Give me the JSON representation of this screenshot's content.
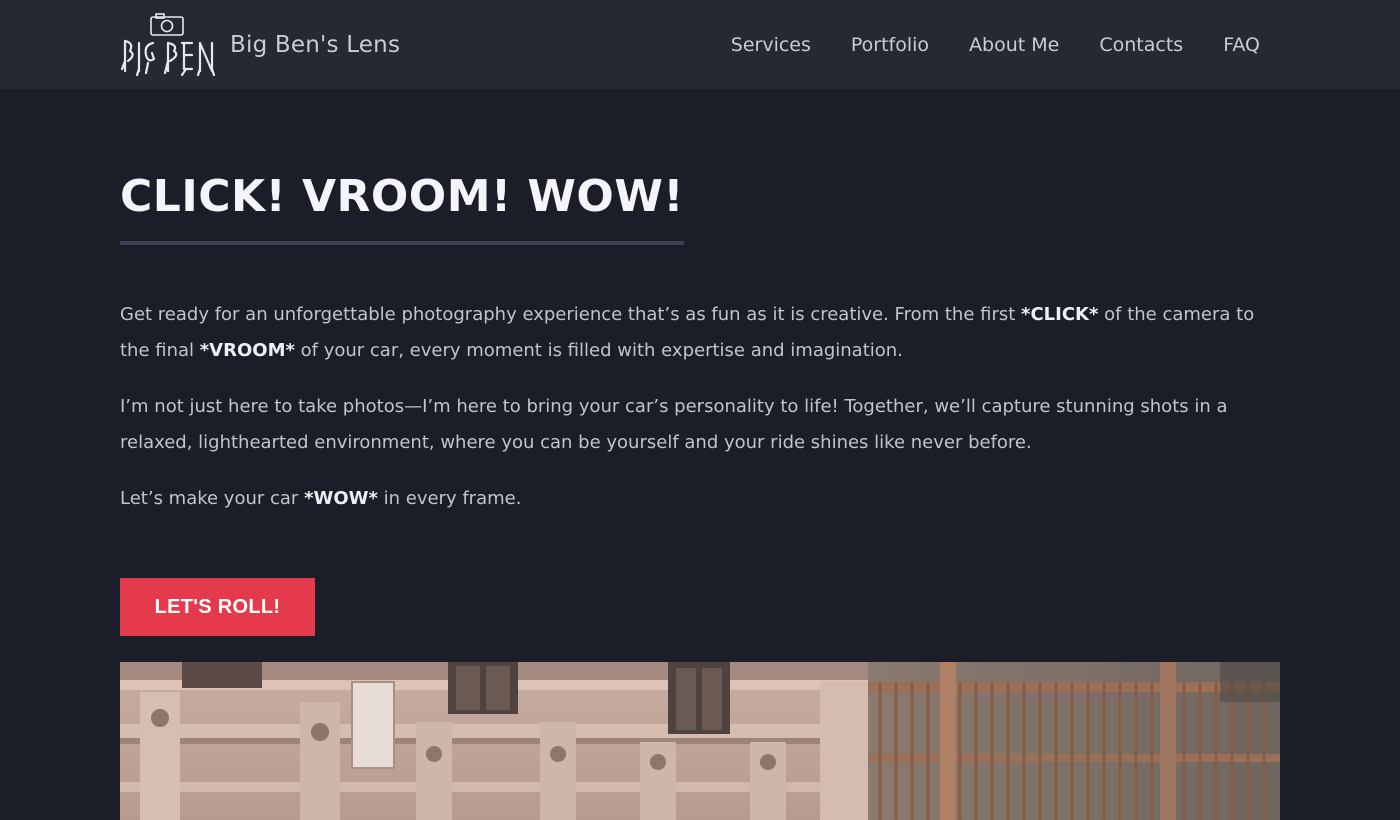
{
  "header": {
    "brand_name": "Big Ben's Lens",
    "logo_text": "BIG BEN",
    "logo_icon": "camera-icon",
    "nav": [
      {
        "label": "Services"
      },
      {
        "label": "Portfolio"
      },
      {
        "label": "About Me"
      },
      {
        "label": "Contacts"
      },
      {
        "label": "FAQ"
      }
    ]
  },
  "hero": {
    "title": "CLICK! VROOM! WOW!",
    "p1_a": "Get ready for an unforgettable photography experience that’s as fun as it is creative. From the first ",
    "p1_b": "*CLICK*",
    "p1_c": " of the camera to the final ",
    "p1_d": "*VROOM*",
    "p1_e": " of your car, every moment is filled with expertise and imagination.",
    "p2": "I’m not just here to take photos—I’m here to bring your car’s personality to life! Together, we’ll capture stunning shots in a relaxed, lighthearted environment, where you can be yourself and your ride shines like never before.",
    "p3_a": "Let’s make your car ",
    "p3_b": "*WOW*",
    "p3_c": " in every frame.",
    "cta_label": "LET'S ROLL!"
  },
  "colors": {
    "background": "#1b1e28",
    "header_bg": "#252934",
    "accent": "#e43a4c",
    "title_underline": "#3a4256"
  }
}
